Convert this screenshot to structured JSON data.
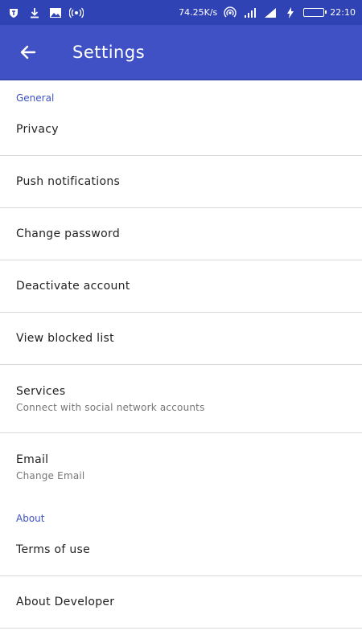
{
  "status_bar": {
    "network_speed": "74.25K/s",
    "time": "22:10",
    "left_icons": [
      "app-icon",
      "download-icon",
      "image-icon",
      "radio-icon"
    ],
    "right_icons": [
      "hotspot-icon",
      "signal-icon",
      "signal-icon",
      "charging-icon",
      "battery-icon"
    ]
  },
  "app_bar": {
    "title": "Settings",
    "back_icon": "arrow-left-icon"
  },
  "sections": {
    "general": {
      "header": "General",
      "items": {
        "privacy": {
          "label": "Privacy"
        },
        "push_notifications": {
          "label": "Push notifications"
        },
        "change_password": {
          "label": "Change password"
        },
        "deactivate_account": {
          "label": "Deactivate account"
        },
        "view_blocked_list": {
          "label": "View blocked list"
        },
        "services": {
          "label": "Services",
          "sub": "Connect with social network accounts"
        },
        "email": {
          "label": "Email",
          "sub": "Change Email"
        }
      }
    },
    "about": {
      "header": "About",
      "items": {
        "terms_of_use": {
          "label": "Terms of use"
        },
        "about_developer": {
          "label": "About Developer"
        }
      }
    }
  },
  "colors": {
    "status_bar": "#2f43b5",
    "app_bar": "#3f51c4",
    "accent": "#3f51c4",
    "divider": "#d9d9d9"
  }
}
